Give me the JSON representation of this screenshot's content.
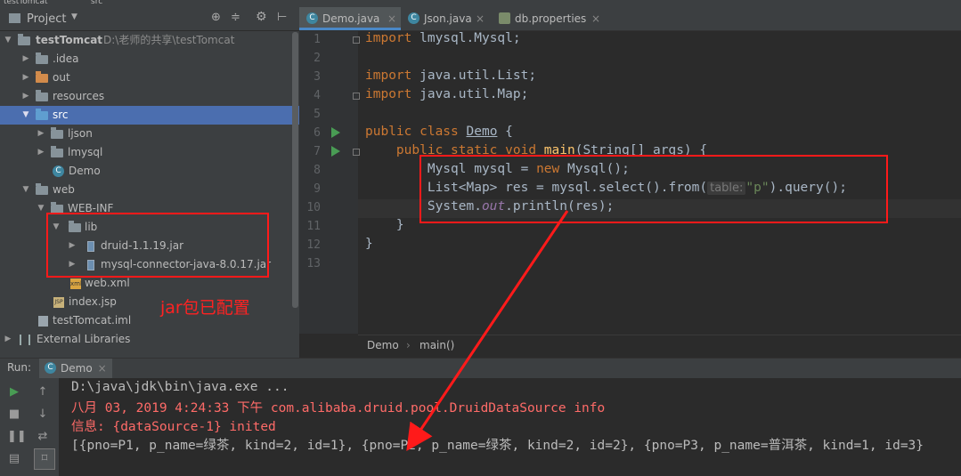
{
  "top_strip": {
    "project": "testTomcat",
    "dir": "src"
  },
  "project_panel": {
    "title": "Project",
    "tree": [
      {
        "label": "testTomcat",
        "sub": "D:\\老师的共享\\testTomcat"
      },
      {
        "label": ".idea"
      },
      {
        "label": "out"
      },
      {
        "label": "resources"
      },
      {
        "label": "src"
      },
      {
        "label": "ljson"
      },
      {
        "label": "lmysql"
      },
      {
        "label": "Demo"
      },
      {
        "label": "web"
      },
      {
        "label": "WEB-INF"
      },
      {
        "label": "lib"
      },
      {
        "label": "druid-1.1.19.jar"
      },
      {
        "label": "mysql-connector-java-8.0.17.jar"
      },
      {
        "label": "web.xml"
      },
      {
        "label": "index.jsp"
      },
      {
        "label": "testTomcat.iml"
      },
      {
        "label": "External Libraries"
      }
    ],
    "annotation": "jar包已配置"
  },
  "editor": {
    "tabs": [
      {
        "label": "Demo.java",
        "active": true
      },
      {
        "label": "Json.java",
        "active": false
      },
      {
        "label": "db.properties",
        "active": false
      }
    ],
    "line_numbers": [
      "1",
      "2",
      "3",
      "4",
      "5",
      "6",
      "7",
      "8",
      "9",
      "10",
      "11",
      "12",
      "13"
    ],
    "code": {
      "l1_kw": "import",
      "l1_rest": " lmysql.Mysql;",
      "l3_kw": "import",
      "l3_rest": " java.util.List;",
      "l4_kw": "import",
      "l4_rest": " java.util.Map;",
      "l6_kw": "public class",
      "l6_name": "Demo",
      "l6_rest": " {",
      "l7_kw": "    public static void",
      "l7_fn": "main",
      "l7_rest": "(String[] args) {",
      "l8_a": "        Mysql mysql = ",
      "l8_kw": "new",
      "l8_b": " Mysql();",
      "l9_a": "        List<Map> res = mysql.select().from(",
      "l9_hint": "table:",
      "l9_str": "\"p\"",
      "l9_b": ").query();",
      "l10_a": "        System.",
      "l10_it": "out",
      "l10_b": ".println(res);",
      "l11": "    }",
      "l12": "}"
    },
    "breadcrumb": [
      "Demo",
      "main()"
    ]
  },
  "run_panel": {
    "label": "Run:",
    "tab": "Demo",
    "console": {
      "line1": "D:\\java\\jdk\\bin\\java.exe ...",
      "line2": "八月 03, 2019 4:24:33 下午 com.alibaba.druid.pool.DruidDataSource info",
      "line3": "信息: {dataSource-1} inited",
      "line4": "[{pno=P1, p_name=绿茶, kind=2, id=1}, {pno=P2, p_name=绿茶, kind=2, id=2}, {pno=P3, p_name=普洱茶, kind=1, id=3}"
    }
  },
  "colors": {
    "annotation_red": "#ff1a1a",
    "selection": "#4b6eaf",
    "keyword": "#cc7832",
    "string": "#6a8759"
  },
  "icons": [
    "gear-icon",
    "target-icon",
    "collapse-icon",
    "run-icon",
    "stop-icon",
    "pause-icon",
    "scroll-up-icon",
    "scroll-down-icon",
    "wrap-icon",
    "print-icon"
  ]
}
